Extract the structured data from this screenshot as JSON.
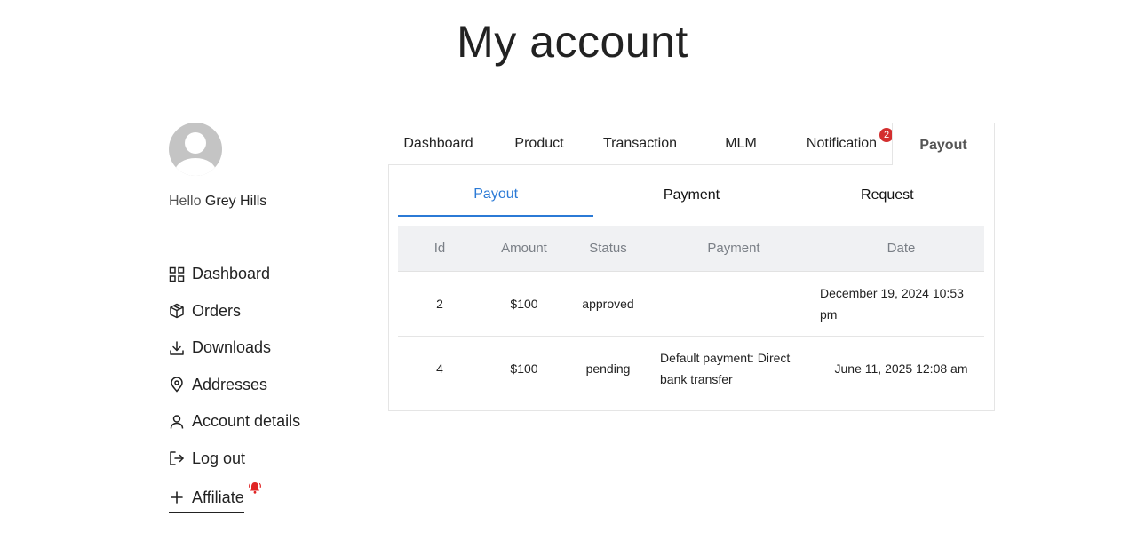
{
  "page": {
    "title": "My account"
  },
  "sidebar": {
    "greeting": "Hello",
    "username": "Grey Hills",
    "items": [
      {
        "label": "Dashboard",
        "icon": "dashboard-grid-icon"
      },
      {
        "label": "Orders",
        "icon": "box-icon"
      },
      {
        "label": "Downloads",
        "icon": "download-icon"
      },
      {
        "label": "Addresses",
        "icon": "map-pin-icon"
      },
      {
        "label": "Account details",
        "icon": "user-icon"
      },
      {
        "label": "Log out",
        "icon": "logout-icon"
      },
      {
        "label": "Affiliate",
        "icon": "plus-icon"
      }
    ]
  },
  "tabs": [
    {
      "label": "Dashboard"
    },
    {
      "label": "Product"
    },
    {
      "label": "Transaction"
    },
    {
      "label": "MLM"
    },
    {
      "label": "Notification",
      "badge": "2"
    },
    {
      "label": "Payout"
    }
  ],
  "subtabs": [
    {
      "label": "Payout"
    },
    {
      "label": "Payment"
    },
    {
      "label": "Request"
    }
  ],
  "table": {
    "headers": [
      "Id",
      "Amount",
      "Status",
      "Payment",
      "Date"
    ],
    "rows": [
      {
        "id": "2",
        "amount": "$100",
        "status": "approved",
        "payment": "",
        "date": "December 19, 2024 10:53 pm"
      },
      {
        "id": "4",
        "amount": "$100",
        "status": "pending",
        "payment": "Default payment: Direct bank transfer",
        "date": "June 11, 2025 12:08 am"
      }
    ]
  },
  "colors": {
    "accent": "#2b7ad6",
    "badge": "#d32f2f",
    "header_bg": "#f0f1f3"
  }
}
